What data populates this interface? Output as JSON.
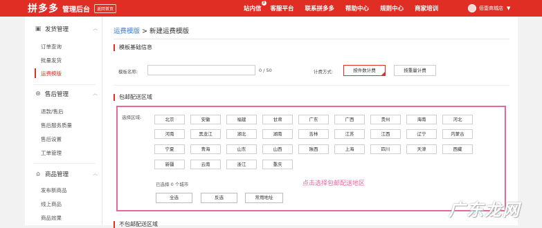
{
  "header": {
    "logo": "拼多多",
    "subtitle": "管理后台",
    "home_button": "返回首页",
    "nav": [
      "站内信",
      "客服平台",
      "联系拼多多",
      "帮助中心",
      "规则中心",
      "商家培训"
    ],
    "message_badge": "3",
    "username": "佰壹商城店"
  },
  "sidebar": {
    "groups": [
      {
        "title": "发货管理",
        "icon": "box-icon",
        "items": [
          "订单查询",
          "批量发货",
          "运费模版"
        ]
      },
      {
        "title": "售后管理",
        "icon": "return-icon",
        "items": [
          "退款/售后",
          "售后服务质量",
          "售后设置",
          "工单管理"
        ]
      },
      {
        "title": "商品管理",
        "icon": "bag-icon",
        "items": [
          "发布新商品",
          "线上商品",
          "商品效果"
        ]
      }
    ],
    "active_item": "运费模版"
  },
  "main": {
    "breadcrumb": {
      "parent": "运费模版",
      "separator": ">",
      "current": "新建运费模版"
    },
    "basic_section": "模板基础信息",
    "name_label": "模板名称:",
    "name_value": "",
    "name_counter": "0 / 50",
    "method_label": "计费方式:",
    "method_options": [
      "按件数计费",
      "按重量计费"
    ],
    "free_section": "包邮配送区域",
    "region_label": "选择区域:",
    "provinces": [
      [
        "北京",
        "安徽",
        "福建",
        "甘肃",
        "广东",
        "广西",
        "贵州",
        "海南",
        "河北"
      ],
      [
        "河南",
        "黑龙江",
        "湖北",
        "湖南",
        "吉林",
        "江苏",
        "江西",
        "辽宁",
        "内蒙古"
      ],
      [
        "宁夏",
        "青海",
        "山东",
        "山西",
        "陕西",
        "上海",
        "四川",
        "天津",
        "西藏"
      ],
      [
        "新疆",
        "云南",
        "浙江",
        "重庆"
      ]
    ],
    "selected_count": "已选择 0 个城市",
    "hint": "点击选择包邮配送地区",
    "buttons": [
      "全选",
      "反选",
      "常用地址"
    ],
    "next_section": "不包邮配送区域"
  },
  "watermark": "广东龙网",
  "colors": {
    "brand": "#e02e24",
    "highlight": "#e8679a",
    "link": "#3a7bd5"
  }
}
